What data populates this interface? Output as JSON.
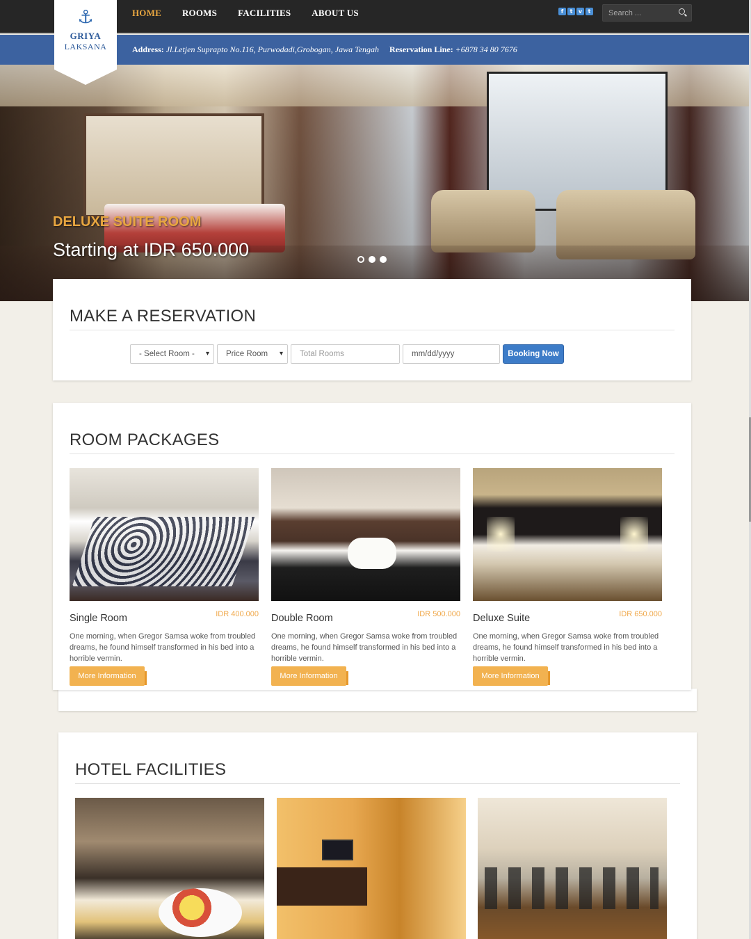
{
  "logo": {
    "line1": "GRIYA",
    "line2": "LAKSANA",
    "icon": "anchor-icon"
  },
  "nav": {
    "items": [
      "HOME",
      "ROOMS",
      "FACILITIES",
      "ABOUT US"
    ],
    "active": "HOME"
  },
  "social": [
    "facebook-icon",
    "twitter-icon",
    "vimeo-icon",
    "tumblr-icon"
  ],
  "search": {
    "placeholder": "Search ..."
  },
  "infobar": {
    "address_label": "Address:",
    "address": "Jl.Letjen Suprapto No.116, Purwodadi,Grobogan, Jawa Tengah",
    "reservation_label": "Reservation Line:",
    "reservation": "+6878 34 80 7676"
  },
  "hero": {
    "caption_title": "DELUXE SUITE ROOM",
    "caption_price": "Starting at IDR 650.000",
    "slides": 3,
    "active_slide": 1
  },
  "reservation": {
    "title": "MAKE A RESERVATION",
    "select_room": "- Select Room -",
    "price_room": "Price Room",
    "total_rooms_placeholder": "Total Rooms",
    "date_placeholder": "mm/dd/yyyy",
    "book_label": "Booking Now"
  },
  "rooms": {
    "title": "ROOM PACKAGES",
    "items": [
      {
        "name": "Single Room",
        "price": "IDR 400.000",
        "desc": "One morning, when Gregor Samsa woke from troubled dreams, he found himself transformed in his bed into a horrible vermin.",
        "button": "More Information"
      },
      {
        "name": "Double Room",
        "price": "IDR 500.000",
        "desc": "One morning, when Gregor Samsa woke from troubled dreams, he found himself transformed in his bed into a horrible vermin.",
        "button": "More Information"
      },
      {
        "name": "Deluxe Suite",
        "price": "IDR 650.000",
        "desc": "One morning, when Gregor Samsa woke from troubled dreams, he found himself transformed in his bed into a horrible vermin.",
        "button": "More Information"
      }
    ]
  },
  "facilities": {
    "title": "HOTEL FACILITIES"
  },
  "colors": {
    "accent": "#e8a640",
    "brand_blue": "#3c62a0",
    "button_blue": "#3d7cc8",
    "button_orange": "#f2b250"
  }
}
